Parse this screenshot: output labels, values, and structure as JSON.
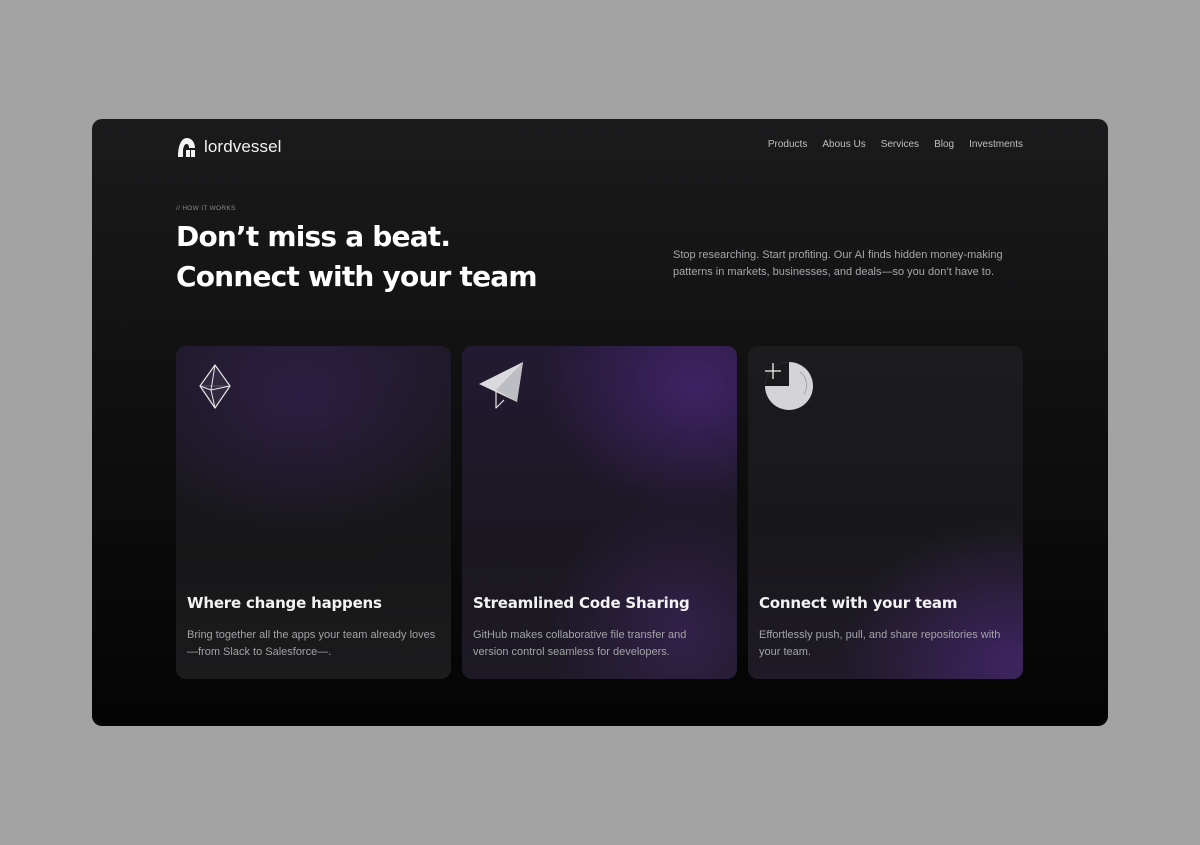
{
  "brand": {
    "name": "lordvessel",
    "logo_icon": "helmet-icon"
  },
  "nav": {
    "items": [
      {
        "label": "Products"
      },
      {
        "label": "Abous Us"
      },
      {
        "label": "Services"
      },
      {
        "label": "Blog"
      },
      {
        "label": "Investments"
      }
    ]
  },
  "hero": {
    "eyebrow": "// HOW IT WORKS",
    "headline_line1": "Don’t miss a beat.",
    "headline_line2": "Connect with your team",
    "description": "Stop researching. Start profiting. Our AI finds hidden money-making patterns in markets, businesses, and deals—so you don’t have to."
  },
  "cards": [
    {
      "icon": "crystal-icon",
      "title": "Where change happens",
      "description": "Bring together all the apps your team already loves—from Slack to Salesforce—."
    },
    {
      "icon": "paper-plane-icon",
      "title": "Streamlined Code Sharing",
      "description": "GitHub makes collaborative file transfer and version control seamless for developers."
    },
    {
      "icon": "sparkle-disc-icon",
      "title": "Connect with your team",
      "description": "Effortlessly push, pull, and share repositories with your team."
    }
  ],
  "colors": {
    "page_background": "#a3a3a3",
    "frame_background": "#101011",
    "accent_purple": "#3a2560",
    "text_primary": "#ffffff",
    "text_secondary": "#a7a7ab"
  }
}
